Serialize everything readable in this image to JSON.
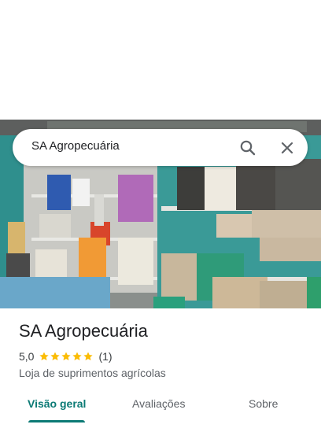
{
  "search": {
    "query": "SA Agropecuária",
    "search_icon": "search-icon",
    "close_icon": "close-icon"
  },
  "place": {
    "name": "SA Agropecuária",
    "rating": "5,0",
    "rating_fraction": 1.0,
    "stars_filled": 5,
    "review_count": "(1)",
    "category": "Loja de suprimentos agrícolas",
    "photo": "store-interior-photo"
  },
  "tabs": [
    {
      "label": "Visão geral",
      "active": true
    },
    {
      "label": "Avaliações",
      "active": false
    },
    {
      "label": "Sobre",
      "active": false
    }
  ],
  "colors": {
    "accent": "#0b7a75",
    "star": "#fbbc04",
    "text_primary": "#202124",
    "text_secondary": "#5f6368"
  }
}
